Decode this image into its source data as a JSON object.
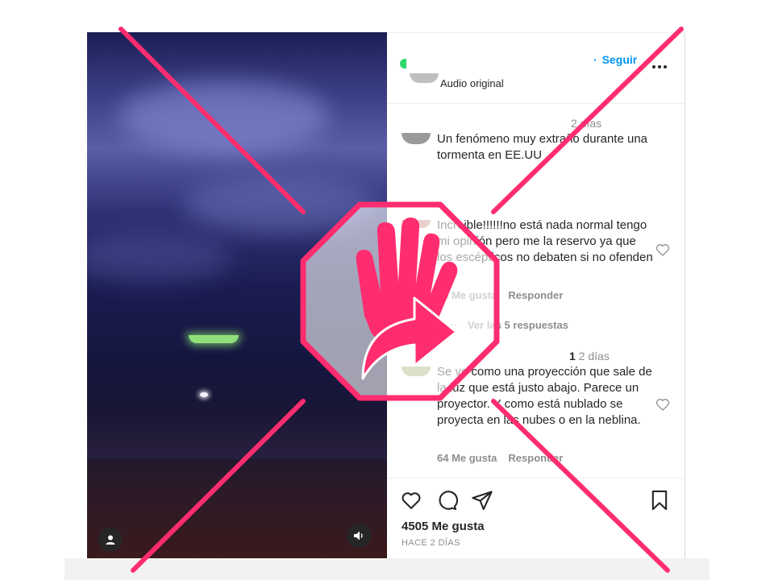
{
  "post": {
    "follow_label": "Seguir",
    "audio_label": "Audio original",
    "caption_time": "2 días",
    "caption": "Un fenómeno muy extraño durante una tormenta en EE.UU"
  },
  "comments": [
    {
      "text": "Increible!!!!!!no está nada normal tengo mi opinión pero me la reservo ya que los escépticos no debaten si no ofenden",
      "likes": "33 Me gusta",
      "reply": "Responder",
      "view_replies": "Ver las 5 respuestas"
    },
    {
      "like_count": "1",
      "time": "2 días",
      "text": "Se ve como una proyección que sale de la luz que está justo abajo. Parece un proyector. Y como está nublado se proyecta en las nubes o en la neblina.",
      "likes": "64 Me gusta",
      "reply": "Responder"
    }
  ],
  "footer": {
    "likes": "4505 Me gusta",
    "date": "HACE 2 DÍAS"
  },
  "icons": {
    "video_user": "user-icon",
    "video_audio": "speaker-icon",
    "more": "more-options-icon",
    "like": "heart-icon",
    "comment": "comment-bubble-icon",
    "share": "paper-plane-icon",
    "save": "bookmark-icon",
    "stamp": "stop-hand-arrow-icon"
  },
  "colors": {
    "accent": "#0095f6",
    "overlay": "#ff2d6f",
    "text": "#262626",
    "muted": "#8e8e8e"
  }
}
